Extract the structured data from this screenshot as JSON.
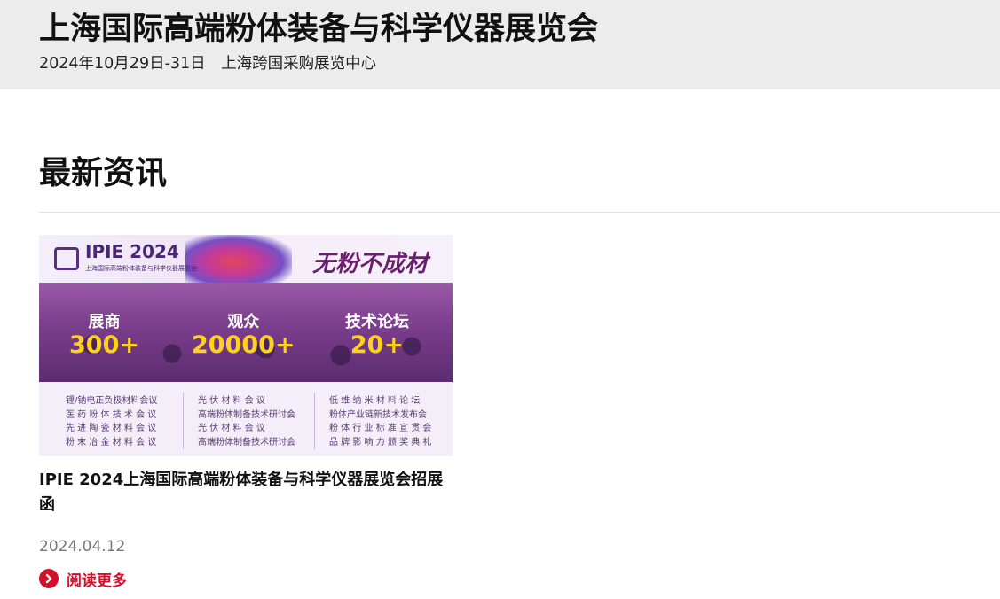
{
  "header": {
    "title": "上海国际高端粉体装备与科学仪器展览会",
    "subtitle": "2024年10月29日-31日　上海跨国采购展览中心"
  },
  "section": {
    "title": "最新资讯"
  },
  "news": [
    {
      "image": {
        "logo_text": "IPIE 2024",
        "logo_subtext": "上海国际高端粉体装备与科学仪器展览会",
        "slogan": "无粉不成材",
        "stats": [
          {
            "label": "展商",
            "value": "300+"
          },
          {
            "label": "观众",
            "value": "20000+"
          },
          {
            "label": "技术论坛",
            "value": "20+"
          }
        ],
        "topics_col1": [
          "锂/钠电正负极材料会议",
          "医 药 粉 体 技 术 会 议",
          "先 进 陶 瓷 材 料 会 议",
          "粉 末 冶 金 材 料 会 议",
          "......"
        ],
        "topics_col2": [
          "光 伏 材 料 会 议",
          "高端粉体制备技术研讨会",
          "光 伏 材 料 会 议",
          "高端粉体制备技术研讨会",
          "......"
        ],
        "topics_col3": [
          "低 维 纳 米 材 料 论 坛",
          "粉体产业链新技术发布会",
          "粉 体 行 业 标 准 宣 贯 会",
          "品 牌 影 响 力 颁 奖 典 礼",
          "......"
        ]
      },
      "title": "IPIE 2024上海国际高端粉体装备与科学仪器展览会招展函",
      "date": "2024.04.12",
      "read_more_label": "阅读更多",
      "read_more_icon": "chevron-right-icon",
      "accent_color": "#d40f2a"
    }
  ]
}
